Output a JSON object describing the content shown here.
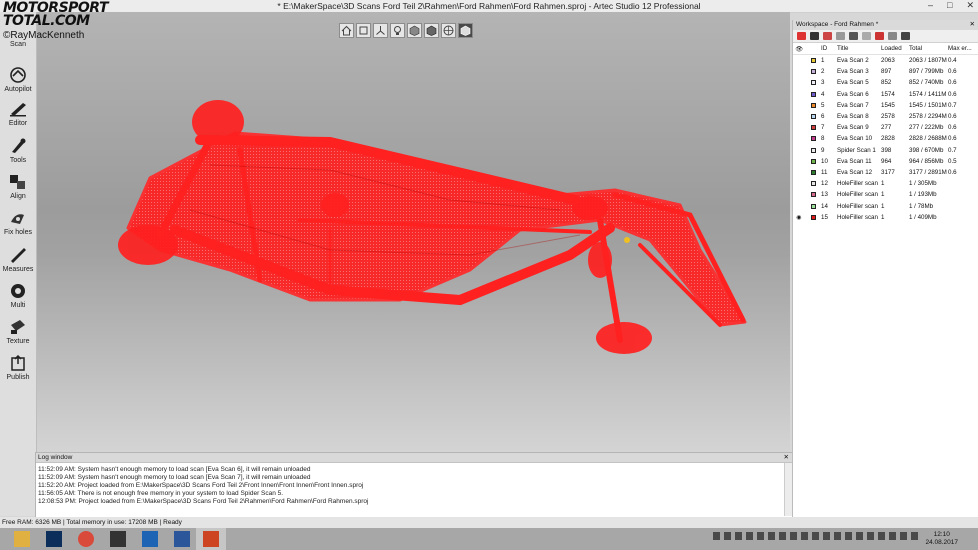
{
  "window": {
    "title": "* E:\\MakerSpace\\3D Scans Ford Teil 2\\Rahmen\\Ford Rahmen\\Ford Rahmen.sproj - Artec Studio 12 Professional"
  },
  "watermark": {
    "brand": "MOTORSPORT",
    "domain": "TOTAL.COM",
    "credit": "©RayMacKenneth"
  },
  "tools": [
    "Scan",
    "Autopilot",
    "Editor",
    "Tools",
    "Align",
    "Fix holes",
    "Measures",
    "Multi",
    "Texture",
    "Publish"
  ],
  "log": {
    "title": "Log window",
    "lines": [
      "11:52:09 AM: System hasn't enough memory to load scan [Eva Scan 6], it will remain unloaded",
      "11:52:09 AM: System hasn't enough memory to load scan [Eva Scan 7], it will remain unloaded",
      "11:52:20 AM: Project loaded from E:\\MakerSpace\\3D Scans Ford Teil 2\\Front Innen\\Front Innen\\Front Innen.sproj",
      "11:56:05 AM: There is not enough free memory in your system to load Spider Scan 5.",
      "12:08:53 PM: Project loaded from E:\\MakerSpace\\3D Scans Ford Teil 2\\Rahmen\\Ford Rahmen\\Ford Rahmen.sproj"
    ]
  },
  "status": {
    "text": "Free RAM: 6326 MB | Total memory in use: 17208 MB | Ready"
  },
  "workspace": {
    "title": "Workspace - Ford Rahmen *",
    "columns": {
      "id": "ID",
      "title": "Title",
      "loaded": "Loaded",
      "total": "Total",
      "max": "Max er..."
    },
    "rows": [
      {
        "eye": "",
        "color": "#e8c93a",
        "id": "1",
        "title": "Eva Scan 2",
        "loaded": "2063",
        "total": "2063 / 1807M",
        "max": "0.4"
      },
      {
        "eye": "",
        "color": "#c7b0d8",
        "id": "2",
        "title": "Eva Scan 3",
        "loaded": "897",
        "total": "897 / 799Mb",
        "max": "0.6"
      },
      {
        "eye": "",
        "color": "#f0ecf6",
        "id": "3",
        "title": "Eva Scan 5",
        "loaded": "852",
        "total": "852 / 740Mb",
        "max": "0.6"
      },
      {
        "eye": "",
        "color": "#6f5bc9",
        "id": "4",
        "title": "Eva Scan 6",
        "loaded": "1574",
        "total": "1574 / 1411M",
        "max": "0.6"
      },
      {
        "eye": "",
        "color": "#ee8a2c",
        "id": "5",
        "title": "Eva Scan 7",
        "loaded": "1545",
        "total": "1545 / 1501M",
        "max": "0.7"
      },
      {
        "eye": "",
        "color": "#b9d7ee",
        "id": "6",
        "title": "Eva Scan 8",
        "loaded": "2578",
        "total": "2578 / 2294M",
        "max": "0.6"
      },
      {
        "eye": "",
        "color": "#d13c3c",
        "id": "7",
        "title": "Eva Scan 9",
        "loaded": "277",
        "total": "277 / 222Mb",
        "max": "0.6"
      },
      {
        "eye": "",
        "color": "#c23d8c",
        "id": "8",
        "title": "Eva Scan 10",
        "loaded": "2828",
        "total": "2828 / 2688M",
        "max": "0.6"
      },
      {
        "eye": "",
        "color": "#e9e9e9",
        "id": "9",
        "title": "Spider Scan 1",
        "loaded": "398",
        "total": "398 / 670Mb",
        "max": "0.7"
      },
      {
        "eye": "",
        "color": "#6fb64a",
        "id": "10",
        "title": "Eva Scan 11",
        "loaded": "964",
        "total": "964 / 856Mb",
        "max": "0.5"
      },
      {
        "eye": "",
        "color": "#2e7d2e",
        "id": "11",
        "title": "Eva Scan 12",
        "loaded": "3177",
        "total": "3177 / 2891M",
        "max": "0.6"
      },
      {
        "eye": "",
        "color": "#e5e5e5",
        "id": "12",
        "title": "HoleFiller scan",
        "loaded": "1",
        "total": "1 / 305Mb",
        "max": ""
      },
      {
        "eye": "",
        "color": "#d36a8e",
        "id": "13",
        "title": "HoleFiller scan",
        "loaded": "1",
        "total": "1 / 193Mb",
        "max": ""
      },
      {
        "eye": "",
        "color": "#9be09b",
        "id": "14",
        "title": "HoleFiller scan",
        "loaded": "1",
        "total": "1 / 78Mb",
        "max": ""
      },
      {
        "eye": "visible",
        "color": "#e01818",
        "id": "15",
        "title": "HoleFiller scan",
        "loaded": "1",
        "total": "1 / 409Mb",
        "max": ""
      }
    ]
  },
  "clock": {
    "time": "12:10",
    "date": "24.08.2017"
  },
  "colors": {
    "pointcloud": "#ff2020",
    "viewport_top": "#b4b4b4",
    "viewport_bottom": "#d4d4d4"
  }
}
